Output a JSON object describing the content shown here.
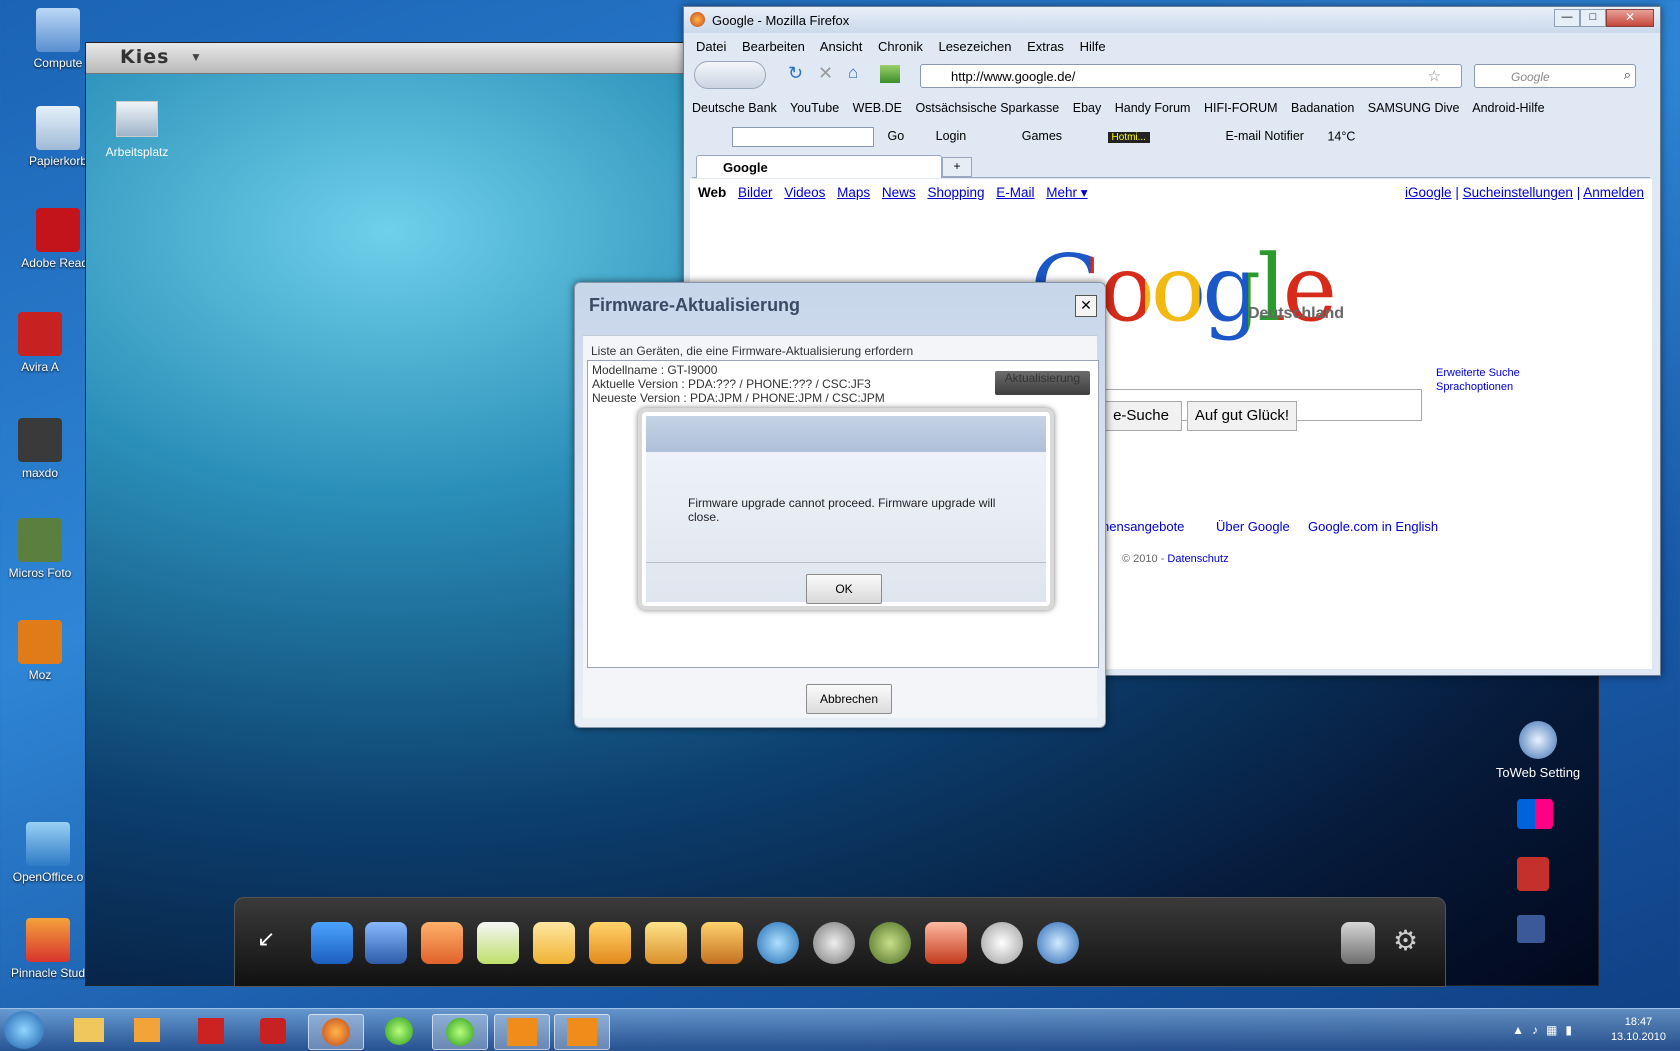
{
  "desktop": {
    "icons": [
      {
        "label": "Compute"
      },
      {
        "label": "Papierkorb"
      },
      {
        "label": "Adobe Reade"
      },
      {
        "label": "Avira A"
      },
      {
        "label": "maxdo"
      },
      {
        "label": "Micros Foto"
      },
      {
        "label": "Moz"
      },
      {
        "label": "OpenOffice.o"
      },
      {
        "label": "Pinnacle Stud"
      }
    ]
  },
  "kies": {
    "logo": "Kies",
    "desktop_item": "Arbeitsplatz",
    "side": {
      "toweb": "ToWeb Setting"
    }
  },
  "firefox": {
    "title": "Google - Mozilla Firefox",
    "menu": [
      "Datei",
      "Bearbeiten",
      "Ansicht",
      "Chronik",
      "Lesezeichen",
      "Extras",
      "Hilfe"
    ],
    "url": "http://www.google.de/",
    "search_placeholder": "Google",
    "bookmarks": [
      "Deutsche Bank",
      "YouTube",
      "WEB.DE",
      "Ostsächsische Sparkasse",
      "Ebay",
      "Handy Forum",
      "HIFI-FORUM",
      "Badanation",
      "SAMSUNG Dive",
      "Android-Hilfe"
    ],
    "toolbar2": {
      "go": "Go",
      "login": "Login",
      "games": "Games",
      "hotmail": "Hotmi...",
      "email_notifier": "E-mail Notifier",
      "temp": "14°C"
    },
    "tab_title": "Google",
    "page": {
      "nav_left": [
        "Web",
        "Bilder",
        "Videos",
        "Maps",
        "News",
        "Shopping",
        "E-Mail",
        "Mehr ▾"
      ],
      "nav_right": [
        "iGoogle",
        "Sucheinstellungen",
        "Anmelden"
      ],
      "logo": "Google",
      "logo_sub": "Deutschland",
      "adv_search": "Erweiterte Suche",
      "lang_options": "Sprachoptionen",
      "btn_search_partial": "e-Suche",
      "btn_lucky": "Auf gut Glück!",
      "footer_links": [
        "nensangebote",
        "Über Google",
        "Google.com in English"
      ],
      "copyright": "© 2010 -",
      "privacy": "Datenschutz"
    }
  },
  "fw_dialog": {
    "title": "Firmware-Aktualisierung",
    "list_label": "Liste an Geräten, die eine Firmware-Aktualisierung erfordern",
    "model": "Modellname : GT-I9000",
    "current": "Aktuelle Version : PDA:??? / PHONE:??? / CSC:JF3",
    "newest": "Neueste Version : PDA:JPM / PHONE:JPM / CSC:JPM",
    "update_btn": "Aktualisierung",
    "cancel_btn": "Abbrechen",
    "close": "✕"
  },
  "error_dialog": {
    "message": "Firmware upgrade cannot proceed. Firmware upgrade will close.",
    "ok": "OK"
  },
  "taskbar": {
    "time": "18:47",
    "date": "13.10.2010"
  }
}
